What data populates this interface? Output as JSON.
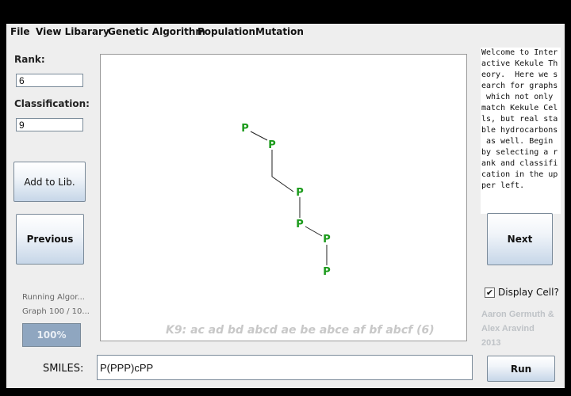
{
  "menu": [
    "File",
    "View Libarary",
    "Genetic Algorithm",
    "Population",
    "Mutation"
  ],
  "left_panel": {
    "rank_label": "Rank:",
    "rank_value": "6",
    "classification_label": "Classification:",
    "classification_value": "9",
    "add_button": "Add to Lib.",
    "previous_button": "Previous",
    "status_line1": "Running Algor...",
    "status_line2": "Graph 100 / 10...",
    "progress_text": "100%",
    "progress_fraction": 1.0
  },
  "info_text": "Welcome to Inter\nactive Kekule Th\neory.  Here we s\nearch for graphs\n which not only \nmatch Kekule Cel\nls, but real sta\nble hydrocarbons\n as well. Begin \nby selecting a r\nank and classifi\ncation in the up\nper left.",
  "right_panel": {
    "next_button": "Next",
    "display_cell_label": "Display Cell?",
    "display_cell_checked": true,
    "credits_line1": "Aaron Germuth &",
    "credits_line2": "Alex Aravind",
    "credits_line3": "2013"
  },
  "graph": {
    "node_label": "P",
    "node_color": "#1a9a1a",
    "edge_color": "#222222",
    "caption": "K9:  ac ad bd abcd ae be abce af bf abcf  (6)"
  },
  "bottom": {
    "smiles_label": "SMILES:",
    "smiles_value": "P(PPP)cPP",
    "run_button": "Run"
  }
}
